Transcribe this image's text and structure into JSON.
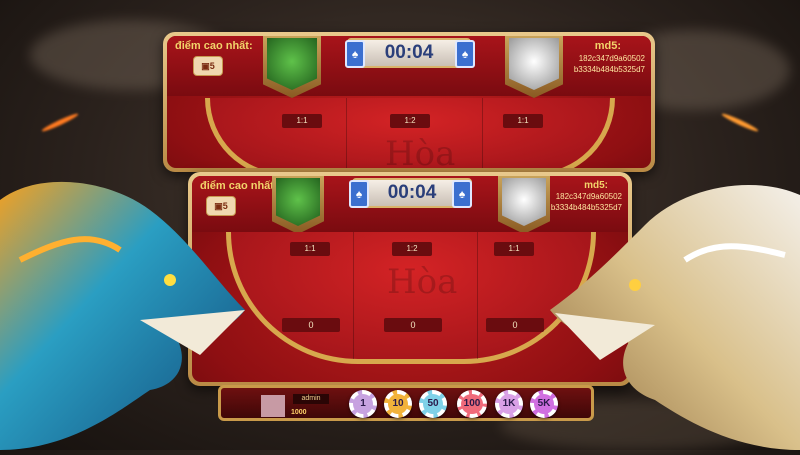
{
  "board_back": {
    "high_score_label": "điểm cao nhất:",
    "high_score_icon": "box-icon",
    "timer": "00:04",
    "md5_label": "md5:",
    "md5_line1": "182c347d9a60502",
    "md5_line2": "b3334b484b5325d7",
    "ratios": [
      "1:1",
      "1:2",
      "1:1"
    ],
    "center_text": "Hòa"
  },
  "board_front": {
    "high_score_label": "điểm cao nhất:",
    "high_score_icon": "box-icon",
    "timer": "00:04",
    "md5_label": "md5:",
    "md5_line1": "182c347d9a60502",
    "md5_line2": "b3334b484b5325d7",
    "ratios": [
      "1:1",
      "1:2",
      "1:1"
    ],
    "center_text": "Hòa",
    "bets": [
      "0",
      "0",
      "0"
    ]
  },
  "player": {
    "name": "admin",
    "balance": "1000"
  },
  "chips": [
    {
      "label": "1",
      "color": "#c7a2e0"
    },
    {
      "label": "10",
      "color": "#f2b23a"
    },
    {
      "label": "50",
      "color": "#7fd1e8"
    },
    {
      "label": "100",
      "color": "#f06a7a"
    },
    {
      "label": "1K",
      "color": "#d9a0e6"
    },
    {
      "label": "5K",
      "color": "#d06fe0"
    }
  ],
  "colors": {
    "table_red": "#a3151a",
    "gold_border": "#d7a84d",
    "timer_text": "#2b3f7a"
  }
}
